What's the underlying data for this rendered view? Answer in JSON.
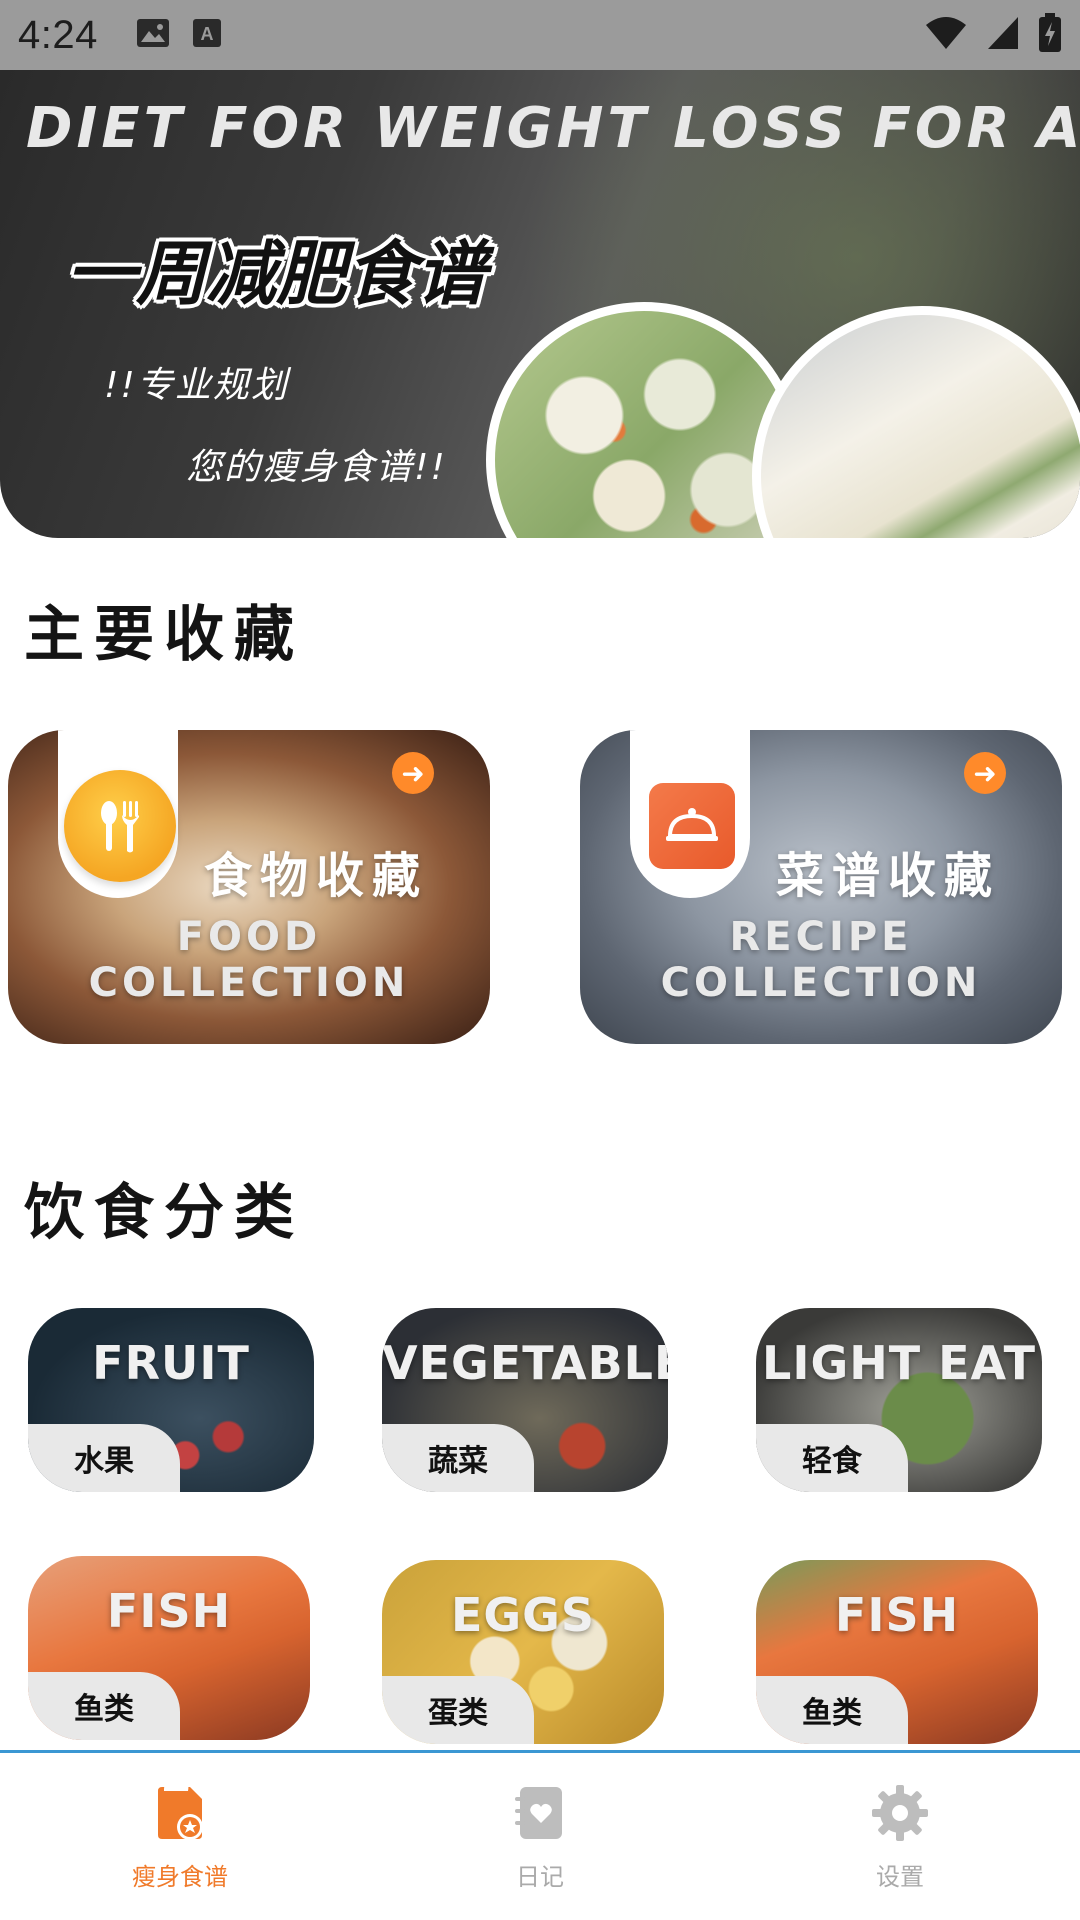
{
  "status_bar": {
    "time": "4:24",
    "icons": [
      "image-icon",
      "font-icon",
      "wifi-icon",
      "signal-icon",
      "battery-icon"
    ]
  },
  "banner": {
    "title_en": "DIET FOR WEIGHT LOSS FOR A WEEK",
    "title_cn": "一周减肥食谱",
    "line1": "!!专业规划",
    "line2": "您的瘦身食谱!!"
  },
  "favorites": {
    "title": "主要收藏",
    "cards": [
      {
        "title_cn": "食物收藏",
        "title_en": "FOOD COLLECTION",
        "icon": "utensils-icon"
      },
      {
        "title_cn": "菜谱收藏",
        "title_en": "RECIPE  COLLECTION",
        "icon": "recipe-book-icon"
      }
    ]
  },
  "categories": {
    "title": "饮食分类",
    "items": [
      {
        "en": "FRUIT",
        "cn": "水果"
      },
      {
        "en": "VEGETABLE",
        "cn": "蔬菜"
      },
      {
        "en": "LIGHT EAT",
        "cn": "轻食"
      },
      {
        "en": "FISH",
        "cn": "鱼类"
      },
      {
        "en": "EGGS",
        "cn": "蛋类"
      },
      {
        "en": "FISH",
        "cn": "鱼类"
      }
    ]
  },
  "bottom_nav": {
    "items": [
      {
        "label": "瘦身食谱",
        "icon": "recipe-star-icon",
        "active": true
      },
      {
        "label": "日记",
        "icon": "diary-heart-icon",
        "active": false
      },
      {
        "label": "设置",
        "icon": "gear-icon",
        "active": false
      }
    ],
    "active_color": "#f07a2a",
    "inactive_color": "#aaaaaa"
  },
  "colors": {
    "accent": "#f6a623",
    "status_bar": "#9b9b9b",
    "nav_border": "#3b97d3"
  }
}
